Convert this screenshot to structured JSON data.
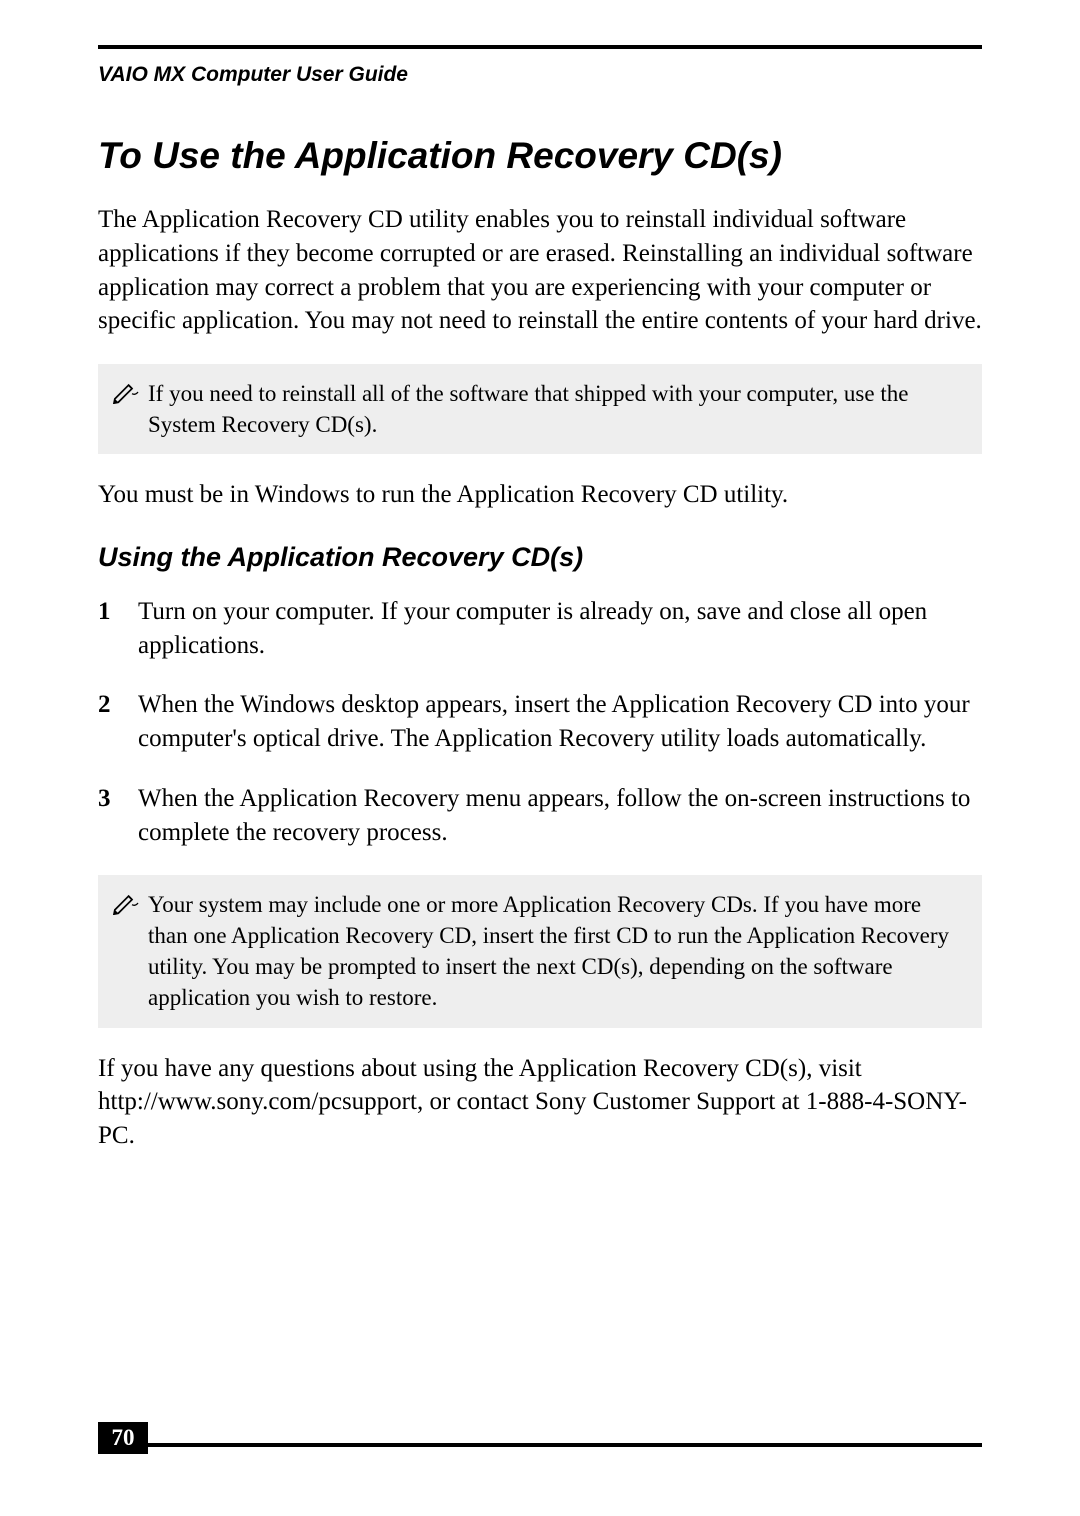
{
  "header": {
    "running": "VAIO MX Computer User Guide"
  },
  "title": "To Use the Application Recovery CD(s)",
  "intro": "The Application Recovery CD utility enables you to reinstall individual software applications if they become corrupted or are erased. Reinstalling an individual software application may correct a problem that you are experiencing with your computer or specific application. You may not need to reinstall the entire contents of your hard drive.",
  "note1": "If you need to reinstall all of the software that shipped with your computer, use the System Recovery CD(s).",
  "para2": "You must be in Windows to run the Application Recovery CD utility.",
  "subhead": "Using the Application Recovery CD(s)",
  "steps": [
    {
      "n": "1",
      "body": "Turn on your computer. If your computer is already on, save and close all open applications."
    },
    {
      "n": "2",
      "body": "When the Windows desktop appears, insert the Application Recovery CD into your computer's optical drive. The Application Recovery utility loads automatically."
    },
    {
      "n": "3",
      "body": "When the Application Recovery menu appears, follow the on-screen instructions to complete the recovery process."
    }
  ],
  "note2": "Your system may include one or more Application Recovery CDs. If you have more than one Application Recovery CD, insert the first CD to run the Application Recovery utility. You may be prompted to insert the next CD(s), depending on the software application you wish to restore.",
  "closing": "If you have any questions about using the Application Recovery CD(s), visit http://www.sony.com/pcsupport, or contact Sony Customer Support at 1-888-4-SONY-PC.",
  "page_number": "70"
}
